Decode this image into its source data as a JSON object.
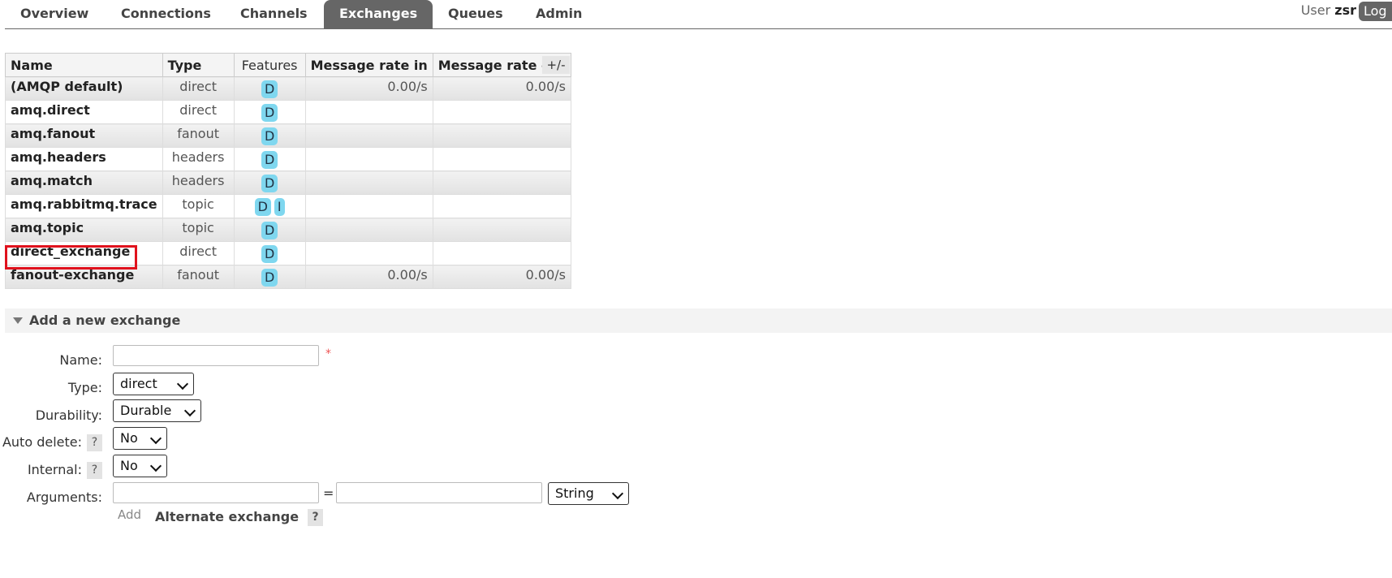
{
  "nav": {
    "tabs": [
      {
        "label": "Overview"
      },
      {
        "label": "Connections"
      },
      {
        "label": "Channels"
      },
      {
        "label": "Exchanges"
      },
      {
        "label": "Queues"
      },
      {
        "label": "Admin"
      }
    ],
    "active_tab": "Exchanges",
    "user_prefix": "User",
    "user_name": "zsr",
    "logout_label": "Log"
  },
  "exchanges": {
    "columns": [
      "Name",
      "Type",
      "Features",
      "Message rate in",
      "Message rate out"
    ],
    "toggle_label": "+/-",
    "rows": [
      {
        "name": "(AMQP default)",
        "type": "direct",
        "features": [
          "D"
        ],
        "rate_in": "0.00/s",
        "rate_out": "0.00/s"
      },
      {
        "name": "amq.direct",
        "type": "direct",
        "features": [
          "D"
        ],
        "rate_in": "",
        "rate_out": ""
      },
      {
        "name": "amq.fanout",
        "type": "fanout",
        "features": [
          "D"
        ],
        "rate_in": "",
        "rate_out": ""
      },
      {
        "name": "amq.headers",
        "type": "headers",
        "features": [
          "D"
        ],
        "rate_in": "",
        "rate_out": ""
      },
      {
        "name": "amq.match",
        "type": "headers",
        "features": [
          "D"
        ],
        "rate_in": "",
        "rate_out": ""
      },
      {
        "name": "amq.rabbitmq.trace",
        "type": "topic",
        "features": [
          "D",
          "I"
        ],
        "rate_in": "",
        "rate_out": ""
      },
      {
        "name": "amq.topic",
        "type": "topic",
        "features": [
          "D"
        ],
        "rate_in": "",
        "rate_out": ""
      },
      {
        "name": "direct_exchange",
        "type": "direct",
        "features": [
          "D"
        ],
        "rate_in": "",
        "rate_out": ""
      },
      {
        "name": "fanout-exchange",
        "type": "fanout",
        "features": [
          "D"
        ],
        "rate_in": "0.00/s",
        "rate_out": "0.00/s"
      }
    ],
    "highlighted_row": "direct_exchange"
  },
  "add_exchange": {
    "title": "Add a new exchange",
    "name_label": "Name:",
    "name_value": "",
    "required_mark": "*",
    "type_label": "Type:",
    "type_value": "direct",
    "durability_label": "Durability:",
    "durability_value": "Durable",
    "auto_delete_label": "Auto delete:",
    "auto_delete_value": "No",
    "internal_label": "Internal:",
    "internal_value": "No",
    "arguments_label": "Arguments:",
    "arguments_equals": "=",
    "arguments_type_value": "String",
    "add_label": "Add",
    "alternate_label": "Alternate exchange",
    "help_glyph": "?"
  },
  "colors": {
    "tab_active_bg": "#666666",
    "badge_bg": "#7fd7ef",
    "highlight_border": "#e0121d"
  }
}
